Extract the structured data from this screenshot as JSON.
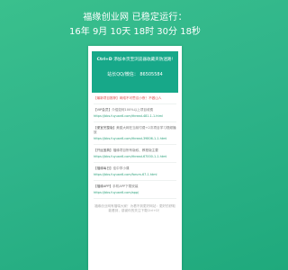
{
  "header": {
    "line1": "福缘创业网 已稳定运行：",
    "line2": "16年 9月 10天 18时 30分 18秒"
  },
  "notice": {
    "hotkey": "Ctrl+D",
    "text": "添加本页至浏览器收藏夹防迷路!",
    "qq": "站长QQ/微信： 86505584"
  },
  "entries": [
    {
      "tag": "【最新项目推荐】",
      "title": "网络不可思议小夜！不做山人",
      "url": ""
    },
    {
      "tag": "【VIP会员】",
      "title": "介绍如何100%以上项目收费",
      "url": "https://bbs.fuyuan6.com/thread-481-1-1.html"
    },
    {
      "tag": "【便宜完整版】",
      "title": "美狐大网在当前付费+2次项目学习视频播放",
      "url": "https://bbs.fuyuan6.com/thread-39806-1-1.html"
    },
    {
      "tag": "【开运宝典】",
      "title": "福缘项目所有版权、教程版主要",
      "url": "https://bbs.fuyuan6.com/thread-67000-1-1.html"
    },
    {
      "tag": "【福缘每日】",
      "title": "佳中学小课",
      "url": "https://bbs.fuyuan6.com/forum-67-1.html"
    },
    {
      "tag": "【福缘APP】",
      "title": "手机APP下载安装",
      "url": "https://bbs.fuyuan6.com/app/"
    }
  ],
  "footer": "福缘创业网有福瑞大家！为看不到更好网站：更好的获取能看到，感谢你的关注下载Ctrl+D！"
}
